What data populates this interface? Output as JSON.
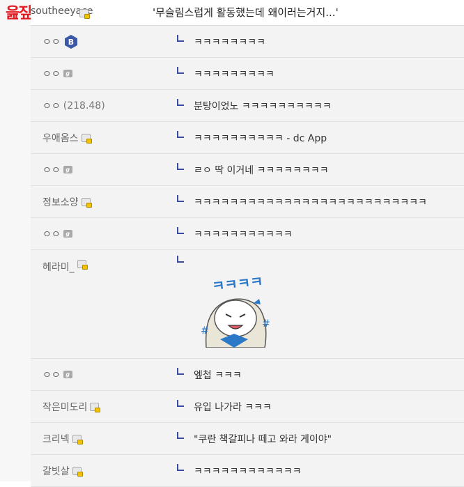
{
  "site": {
    "logo_text": "읊짚"
  },
  "post": {
    "author": "southeeyace",
    "title": "'무슬림스럽게 활동했는데 왜이러는거지...'"
  },
  "comments": [
    {
      "author": "ㅇㅇ",
      "ip": "",
      "badge": "b-badge-icon",
      "text": "ㅋㅋㅋㅋㅋㅋㅋㅋ",
      "type": "text"
    },
    {
      "author": "ㅇㅇ",
      "ip": "",
      "badge": "fluid-nick-icon",
      "text": "ㅋㅋㅋㅋㅋㅋㅋㅋㅋ",
      "type": "text"
    },
    {
      "author": "ㅇㅇ",
      "ip": "(218.48)",
      "badge": "",
      "text": "분탕이었노 ㅋㅋㅋㅋㅋㅋㅋㅋㅋㅋ",
      "type": "text"
    },
    {
      "author": "우애옴스",
      "ip": "",
      "badge": "fixed-nick-icon",
      "text": "ㅋㅋㅋㅋㅋㅋㅋㅋㅋㅋ - dc App",
      "type": "text"
    },
    {
      "author": "ㅇㅇ",
      "ip": "",
      "badge": "fluid-nick-icon",
      "text": "ㄹㅇ 딱 이거네 ㅋㅋㅋㅋㅋㅋㅋㅋ",
      "type": "text"
    },
    {
      "author": "정보소양",
      "ip": "",
      "badge": "fixed-nick-icon",
      "text": "ㅋㅋㅋㅋㅋㅋㅋㅋㅋㅋㅋㅋㅋㅋㅋㅋㅋㅋㅋㅋㅋㅋㅋㅋㅋㅋ",
      "type": "text"
    },
    {
      "author": "ㅇㅇ",
      "ip": "",
      "badge": "fluid-nick-icon",
      "text": "ㅋㅋㅋㅋㅋㅋㅋㅋㅋㅋㅋ",
      "type": "text"
    },
    {
      "author": "헤라미_",
      "ip": "",
      "badge": "fixed-nick-icon",
      "text": "",
      "type": "sticker",
      "sticker_text": "ㅋㅋㅋㅋ"
    },
    {
      "author": "ㅇㅇ",
      "ip": "",
      "badge": "fluid-nick-icon",
      "text": "엪첩 ㅋㅋㅋ",
      "type": "text"
    },
    {
      "author": "작은미도리",
      "ip": "",
      "badge": "fixed-nick-icon",
      "text": "유입 나가라 ㅋㅋㅋ",
      "type": "text"
    },
    {
      "author": "크리넥",
      "ip": "",
      "badge": "fixed-nick-icon",
      "text": "\"쿠란 책갈피나 떼고 와라 게이야\"",
      "type": "text"
    },
    {
      "author": "갈빗살",
      "ip": "",
      "badge": "fixed-nick-icon",
      "text": "ㅋㅋㅋㅋㅋㅋㅋㅋㅋㅋㅋㅋ",
      "type": "text"
    }
  ],
  "colors": {
    "logo": "#e21b22",
    "reply_mark": "#3b4aa1",
    "row_bg": "#f3f3f3",
    "badge_blue": "#3b59a8"
  }
}
